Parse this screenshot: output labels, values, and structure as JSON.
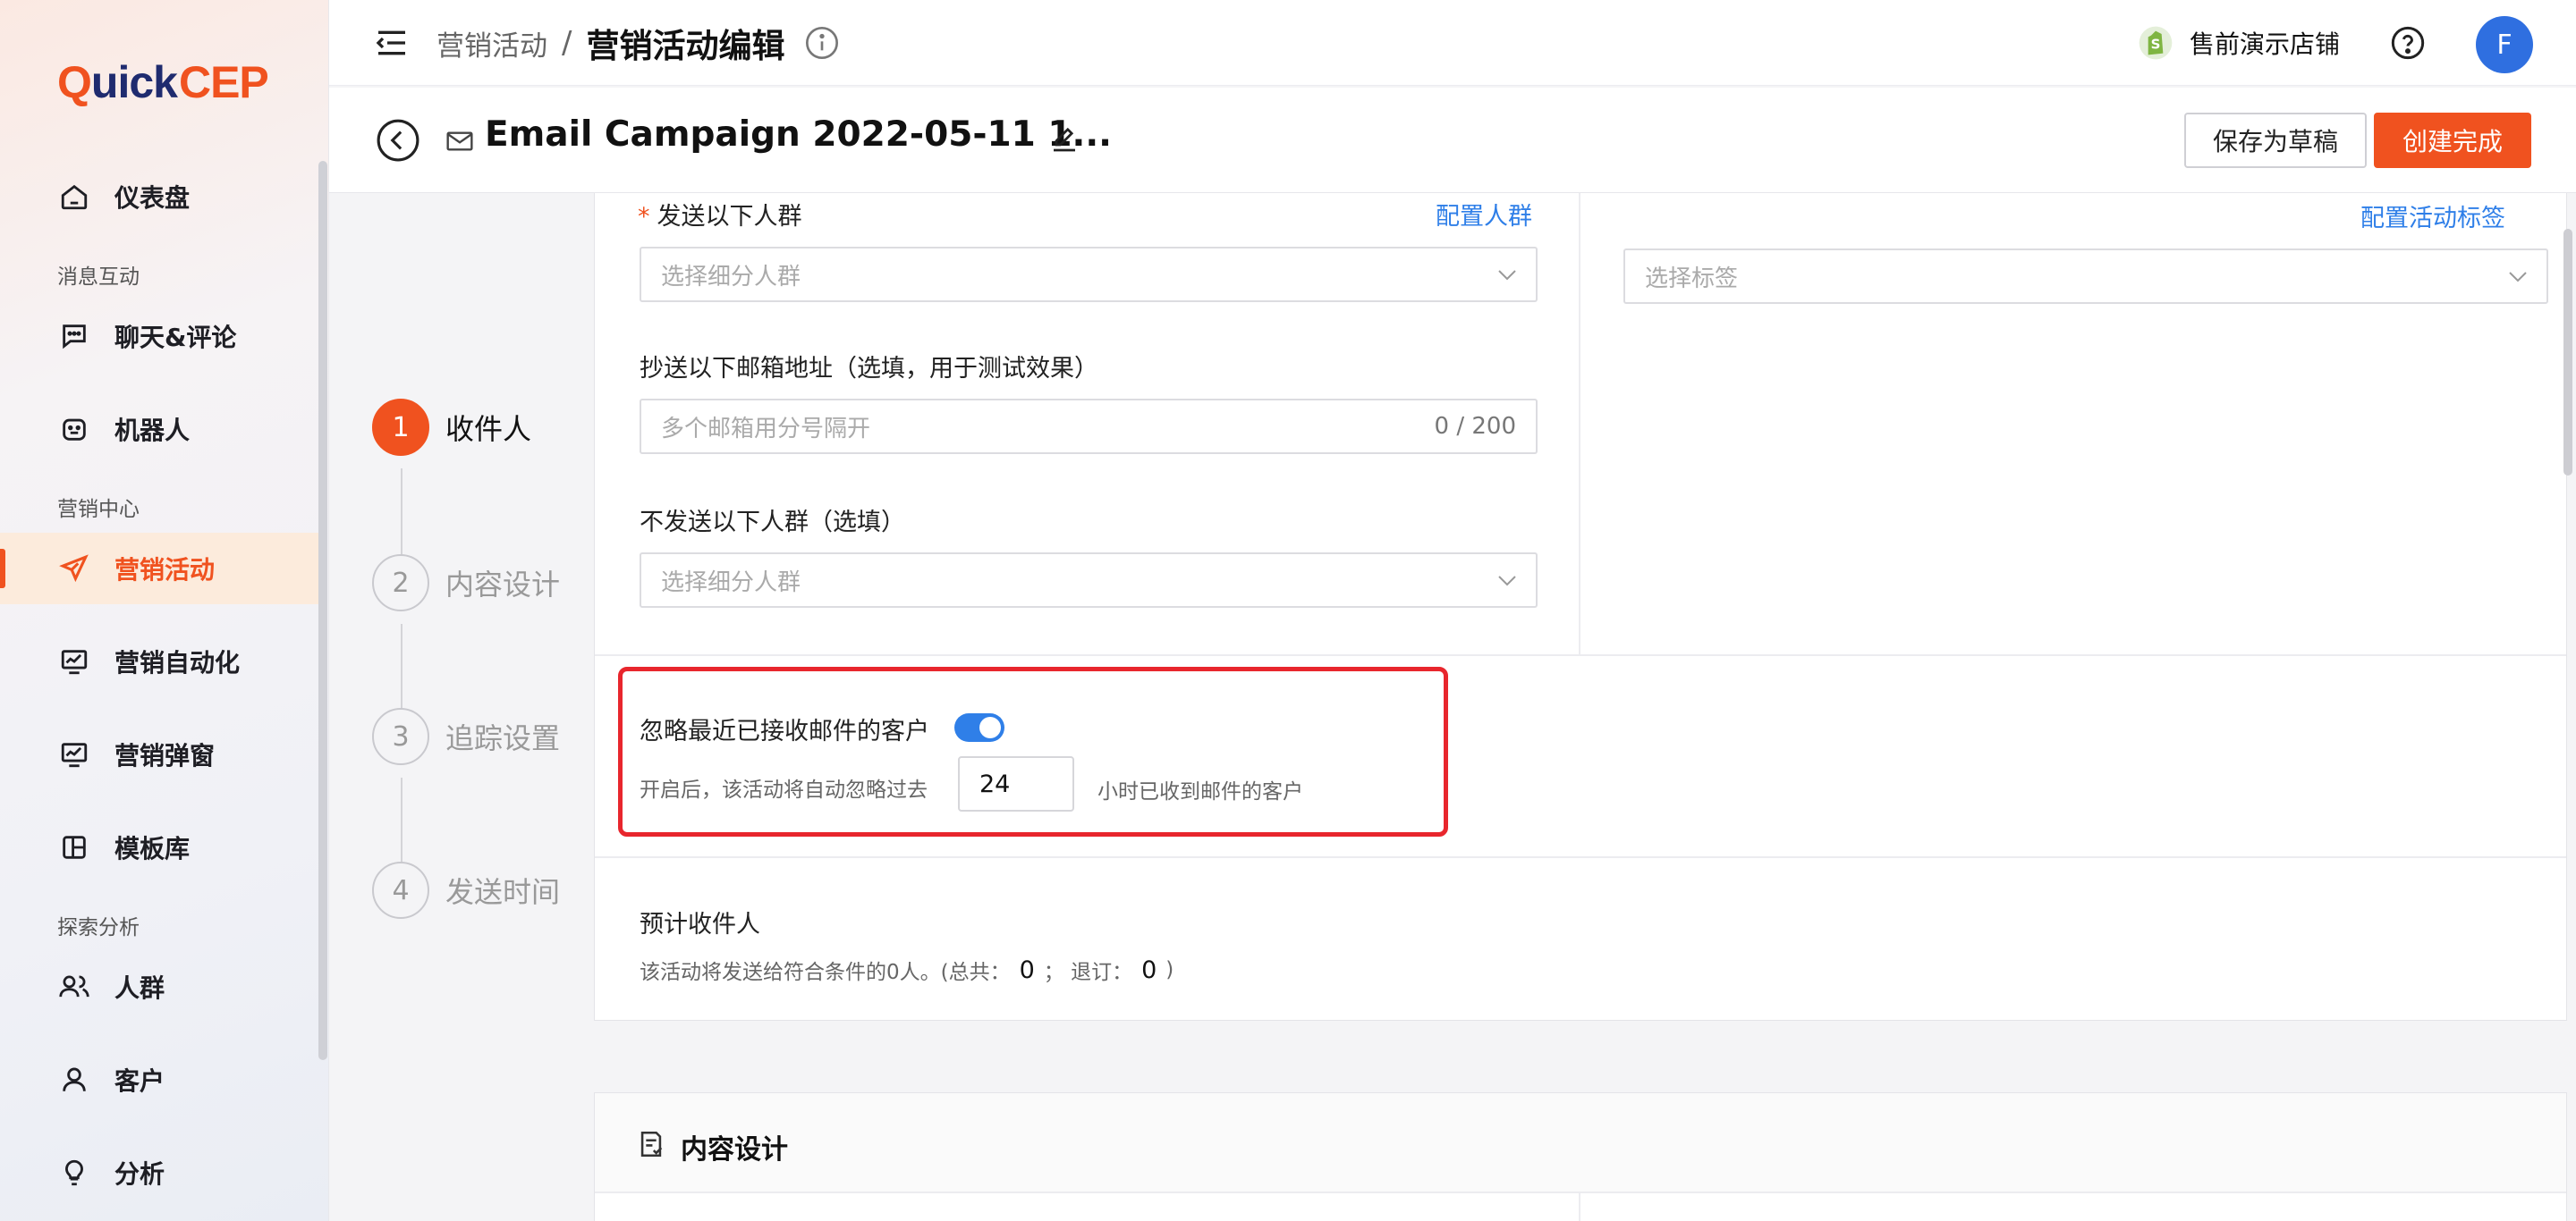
{
  "sidebar": {
    "logo": {
      "q": "Q",
      "uick": "uick",
      "cep": "CEP"
    },
    "items": [
      {
        "label": "仪表盘",
        "icon": "home-icon"
      },
      {
        "label": "聊天&评论",
        "icon": "chat-icon"
      },
      {
        "label": "机器人",
        "icon": "robot-icon"
      },
      {
        "label": "营销活动",
        "icon": "send-icon",
        "active": true
      },
      {
        "label": "营销自动化",
        "icon": "automation-icon"
      },
      {
        "label": "营销弹窗",
        "icon": "popup-icon"
      },
      {
        "label": "模板库",
        "icon": "template-icon"
      },
      {
        "label": "人群",
        "icon": "users-icon"
      },
      {
        "label": "客户",
        "icon": "user-icon"
      },
      {
        "label": "分析",
        "icon": "bulb-icon"
      }
    ],
    "sections": [
      "消息互动",
      "营销中心",
      "探索分析"
    ]
  },
  "header": {
    "breadcrumb_parent": "营销活动",
    "breadcrumb_sep": "/",
    "breadcrumb_current": "营销活动编辑",
    "store_name": "售前演示店铺",
    "avatar_letter": "F"
  },
  "campaign": {
    "name": "Email Campaign 2022-05-11 1...",
    "save_draft_label": "保存为草稿",
    "finish_label": "创建完成"
  },
  "steps": [
    {
      "num": "1",
      "label": "收件人",
      "active": true
    },
    {
      "num": "2",
      "label": "内容设计"
    },
    {
      "num": "3",
      "label": "追踪设置"
    },
    {
      "num": "4",
      "label": "发送时间"
    }
  ],
  "form": {
    "send_to_label": "发送以下人群",
    "required_mark": "*",
    "configure_audience_link": "配置人群",
    "send_to_placeholder": "选择细分人群",
    "configure_tag_link": "配置活动标签",
    "tag_placeholder": "选择标签",
    "cc_label": "抄送以下邮箱地址（选填，用于测试效果）",
    "cc_placeholder": "多个邮箱用分号隔开",
    "cc_counter": "0 / 200",
    "exclude_label": "不发送以下人群（选填）",
    "exclude_placeholder": "选择细分人群",
    "ignore_label": "忽略最近已接收邮件的客户",
    "ignore_enabled": true,
    "ignore_hint_before": "开启后，该活动将自动忽略过去",
    "ignore_hours": "24",
    "ignore_hint_after": "小时已收到邮件的客户",
    "estimate_label": "预计收件人",
    "estimate_text_before": "该活动将发送给符合条件的0人。(总共：",
    "estimate_total": "0",
    "estimate_mid": "；  退订：",
    "estimate_unsub": "0",
    "estimate_close": ")"
  },
  "content_section": {
    "title": "内容设计"
  },
  "colors": {
    "accent": "#f0521f",
    "link": "#2f7fe8",
    "highlight": "#e8262d"
  }
}
